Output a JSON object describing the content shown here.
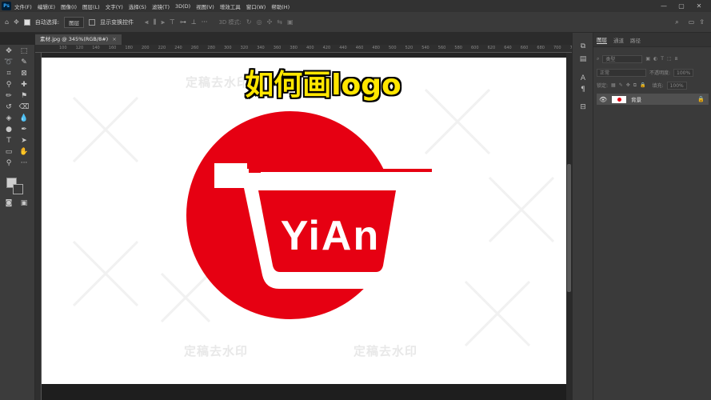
{
  "app": {
    "icon_label": "Ps"
  },
  "menu": [
    "文件(F)",
    "编辑(E)",
    "图像(I)",
    "图层(L)",
    "文字(Y)",
    "选择(S)",
    "滤镜(T)",
    "3D(D)",
    "视图(V)",
    "增效工具",
    "窗口(W)",
    "帮助(H)"
  ],
  "window_controls": {
    "minimize": "—",
    "maximize": "▢",
    "close": "✕"
  },
  "options": {
    "auto_select_label": "自动选择:",
    "auto_select_value": "图层",
    "show_transform_label": "显示变换控件",
    "mode_3d_label": "3D 模式:"
  },
  "document": {
    "tab_title": "素材.jpg @ 345%(RGB/8#)",
    "close": "×"
  },
  "ruler_ticks": [
    "100",
    "120",
    "140",
    "160",
    "180",
    "200",
    "220",
    "240",
    "260",
    "280",
    "300",
    "320",
    "340",
    "360",
    "380",
    "400",
    "420",
    "440",
    "460",
    "480",
    "500",
    "520",
    "540",
    "560",
    "580",
    "600",
    "620",
    "640",
    "660",
    "680",
    "700",
    "72"
  ],
  "canvas": {
    "overlay_title": "如何画logo",
    "logo_text": "YiAn",
    "watermarks": [
      "定稿去水印",
      "定稿去水印",
      "定稿去水印"
    ],
    "colors": {
      "brand_red": "#e60012",
      "title_yellow": "#ffe600"
    }
  },
  "layers_panel": {
    "tabs": [
      "图层",
      "通道",
      "路径"
    ],
    "kind_filter": "类型",
    "blend_mode": "正常",
    "opacity_label": "不透明度:",
    "opacity_value": "100%",
    "lock_label": "锁定:",
    "fill_label": "填充:",
    "fill_value": "100%",
    "layers": [
      {
        "name": "背景",
        "locked": true,
        "visible": true
      }
    ]
  }
}
